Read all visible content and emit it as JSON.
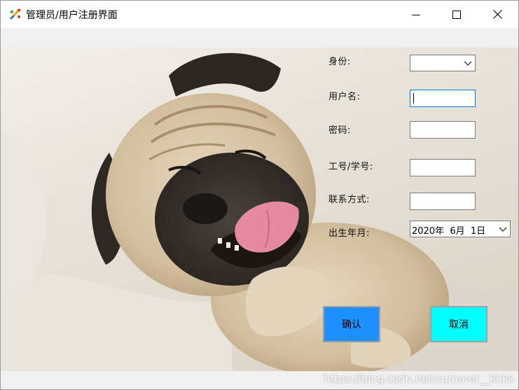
{
  "window": {
    "title": "管理员/用户注册界面",
    "icon": "paint-brush-app-icon",
    "controls": [
      "minimize-icon",
      "maximize-icon",
      "close-icon"
    ]
  },
  "background": {
    "image": "smiling-pug-photo",
    "pug_colors": {
      "fur": "#d9c6a8",
      "mask": "#3a3530",
      "tongue": "#e58aa0"
    }
  },
  "form": {
    "role_label": "身份:",
    "role_value": "",
    "username_label": "用户名:",
    "username_value": "",
    "password_label": "密码:",
    "password_value": "",
    "id_label": "工号/学号:",
    "id_value": "",
    "contact_label": "联系方式:",
    "contact_value": "",
    "birthdate_label": "出生年月:",
    "birthdate_value": "2020年  6月  1日"
  },
  "buttons": {
    "confirm": "确认",
    "cancel": "取消"
  },
  "colors": {
    "confirm_bg": "#1e90ff",
    "cancel_bg": "#00ffff",
    "focus_border": "#0078d7"
  },
  "watermark": "https://blog.csdn.net/summer__kkkk"
}
